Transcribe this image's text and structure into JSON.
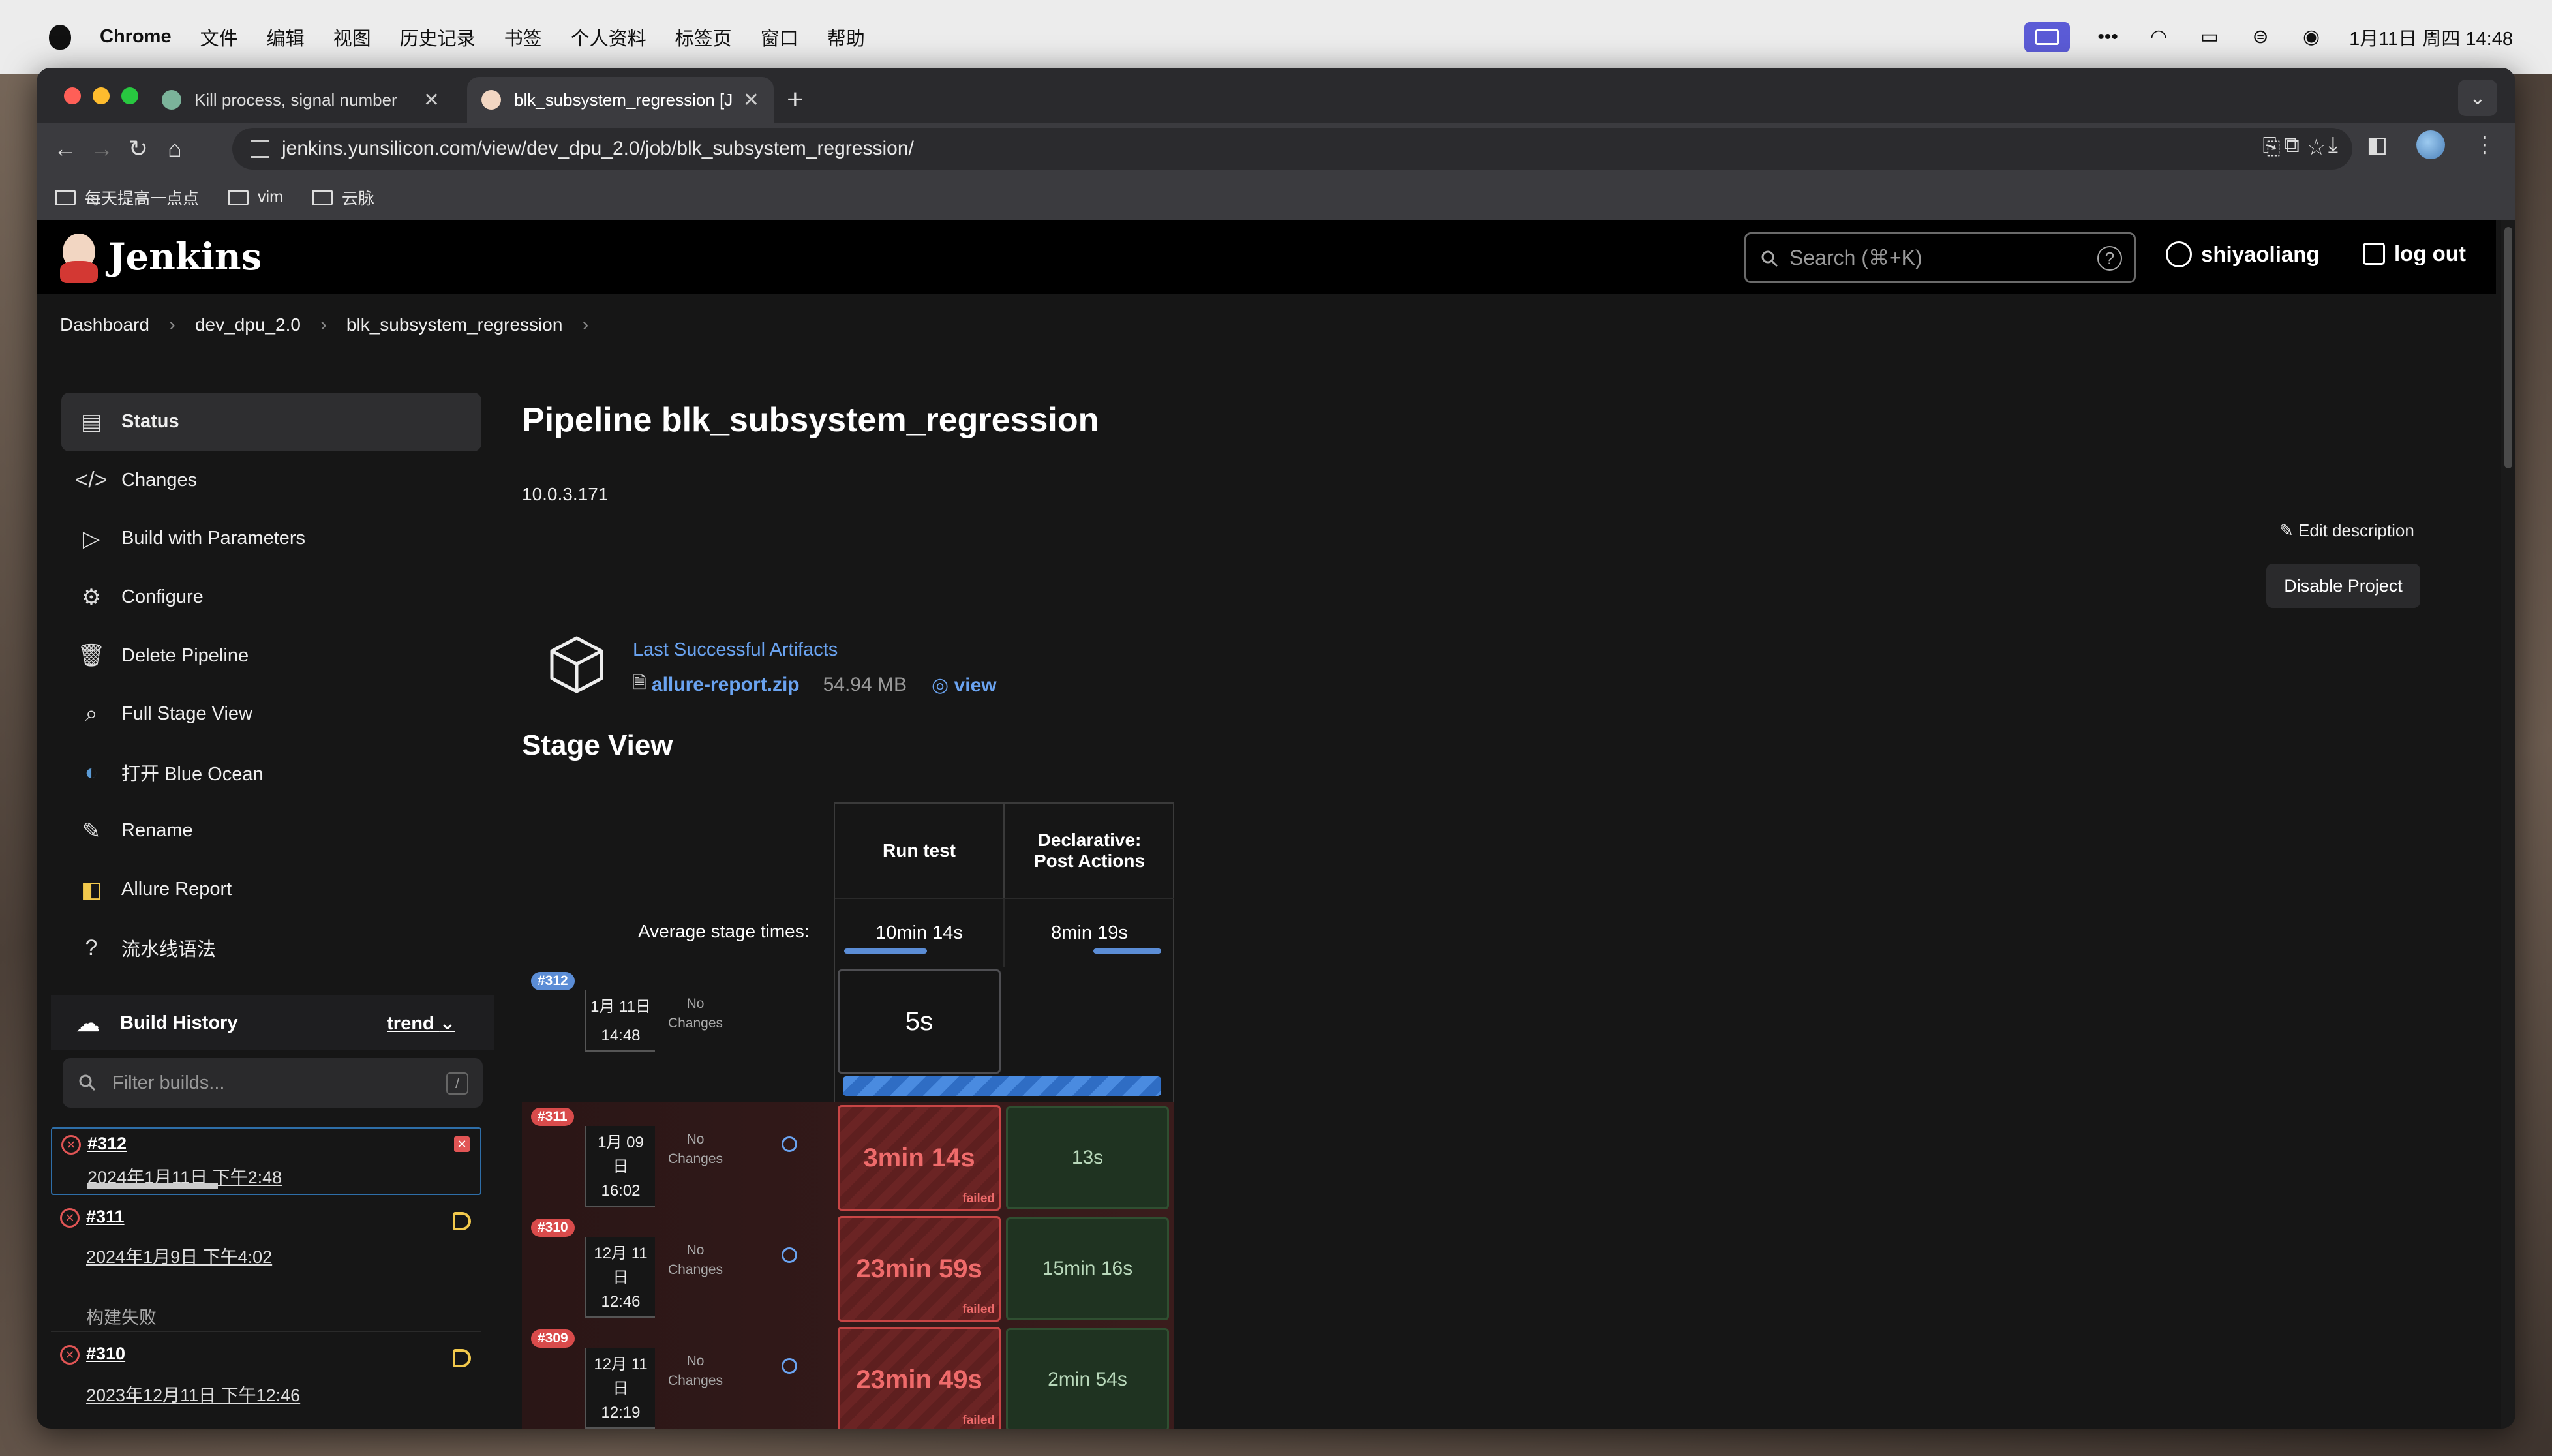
{
  "menubar": {
    "app": "Chrome",
    "items": [
      "文件",
      "编辑",
      "视图",
      "历史记录",
      "书签",
      "个人资料",
      "标签页",
      "窗口",
      "帮助"
    ],
    "datetime": "1月11日 周四 14:48"
  },
  "tabs": [
    {
      "title": "Kill process, signal number",
      "active": false
    },
    {
      "title": "blk_subsystem_regression [J",
      "active": true
    }
  ],
  "toolbar": {
    "url": "jenkins.yunsilicon.com/view/dev_dpu_2.0/job/blk_subsystem_regression/"
  },
  "bookmarks": [
    "每天提高一点点",
    "vim",
    "云脉"
  ],
  "jenkins": {
    "logo_text": "Jenkins",
    "search_placeholder": "Search (⌘+K)",
    "user": "shiyaoliang",
    "logout": "log out"
  },
  "breadcrumb": [
    "Dashboard",
    "dev_dpu_2.0",
    "blk_subsystem_regression"
  ],
  "sidebar": {
    "items": [
      {
        "label": "Status",
        "icon": "document-icon",
        "glyph": "▤"
      },
      {
        "label": "Changes",
        "icon": "code-icon",
        "glyph": "</>"
      },
      {
        "label": "Build with Parameters",
        "icon": "play-icon",
        "glyph": "▷"
      },
      {
        "label": "Configure",
        "icon": "gear-icon",
        "glyph": "⚙"
      },
      {
        "label": "Delete Pipeline",
        "icon": "trash-icon",
        "glyph": "🗑"
      },
      {
        "label": "Full Stage View",
        "icon": "search-icon",
        "glyph": "⌕"
      },
      {
        "label": "打开 Blue Ocean",
        "icon": "blue-ocean-icon",
        "glyph": "◐"
      },
      {
        "label": "Rename",
        "icon": "pencil-icon",
        "glyph": "✎"
      },
      {
        "label": "Allure Report",
        "icon": "allure-icon",
        "glyph": "◧"
      },
      {
        "label": "流水线语法",
        "icon": "help-icon",
        "glyph": "?"
      }
    ]
  },
  "build_history": {
    "title": "Build History",
    "trend": "trend",
    "filter_placeholder": "Filter builds...",
    "filter_shortcut": "/",
    "builds": [
      {
        "number": "#312",
        "date": "2024年1月11日 下午2:48",
        "note": ""
      },
      {
        "number": "#311",
        "date": "2024年1月9日 下午4:02",
        "note": "构建失败"
      },
      {
        "number": "#310",
        "date": "2023年12月11日 下午12:46",
        "note": ""
      }
    ]
  },
  "main": {
    "title": "Pipeline blk_subsystem_regression",
    "description": "10.0.3.171",
    "edit_description": "Edit description",
    "disable_project": "Disable Project",
    "artifacts_title": "Last Successful Artifacts",
    "artifact_file": "allure-report.zip",
    "artifact_size": "54.94 MB",
    "artifact_view": "view"
  },
  "stage_view": {
    "title": "Stage View",
    "avg_label": "Average stage times:",
    "stages": [
      {
        "name": "Run test",
        "avg": "10min 14s",
        "avg_fraction": 0.55
      },
      {
        "name": "Declarative: Post Actions",
        "avg": "8min 19s",
        "avg_fraction": 0.45
      }
    ],
    "no_changes": "No Changes",
    "failed_label": "failed",
    "runs": [
      {
        "badge": "#312",
        "date_line1": "1月 11日",
        "date_line2": "14:48",
        "cells": [
          "5s",
          ""
        ],
        "status": "running"
      },
      {
        "badge": "#311",
        "date_line1": "1月 09",
        "date_line1b": "日",
        "date_line2": "16:02",
        "cells": [
          "3min 14s",
          "13s"
        ],
        "status": "failed"
      },
      {
        "badge": "#310",
        "date_line1": "12月 11",
        "date_line1b": "日",
        "date_line2": "12:46",
        "cells": [
          "23min 59s",
          "15min 16s"
        ],
        "status": "failed"
      },
      {
        "badge": "#309",
        "date_line1": "12月 11",
        "date_line1b": "日",
        "date_line2": "12:19",
        "cells": [
          "23min 49s",
          "2min 54s"
        ],
        "status": "failed"
      }
    ]
  },
  "colors": {
    "failed_red": "#c74545",
    "success_green": "#2f4f31",
    "link_blue": "#6aa3f0",
    "running_badge": "#5b8dd6",
    "failed_badge": "#d94b4b"
  }
}
